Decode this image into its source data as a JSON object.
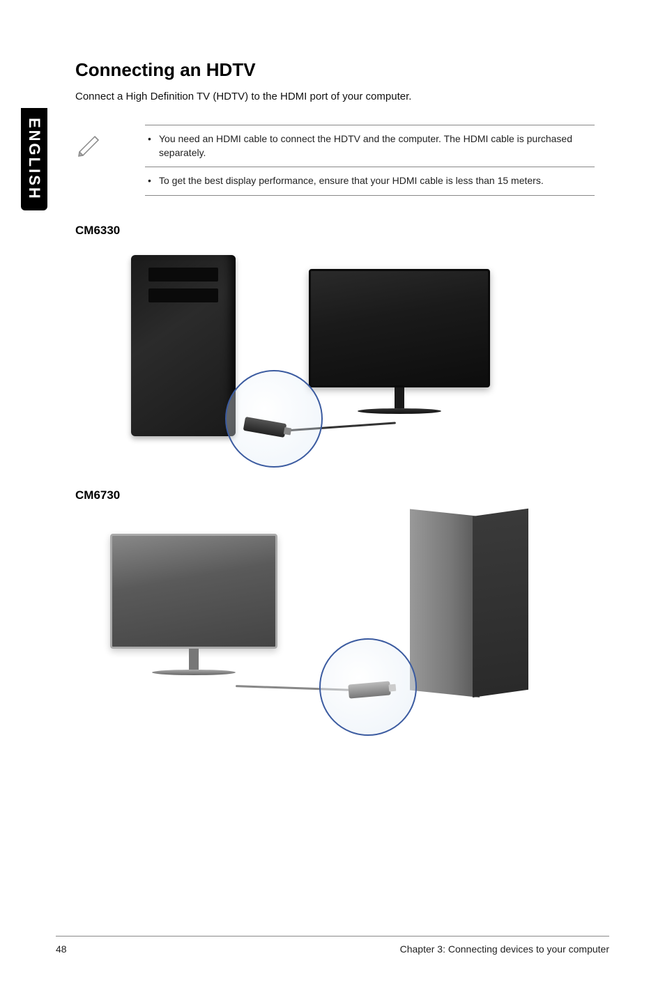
{
  "language_tab": "ENGLISH",
  "heading": "Connecting an HDTV",
  "intro": "Connect a High Definition TV (HDTV) to the HDMI port of your computer.",
  "notes": {
    "item1": "You need an HDMI cable to connect the HDTV and the computer. The HDMI cable is purchased separately.",
    "item2": "To get the best display performance, ensure that your HDMI cable is less than 15 meters."
  },
  "model1": "CM6330",
  "model2": "CM6730",
  "footer": {
    "page": "48",
    "chapter": "Chapter 3: Connecting devices to your computer"
  }
}
